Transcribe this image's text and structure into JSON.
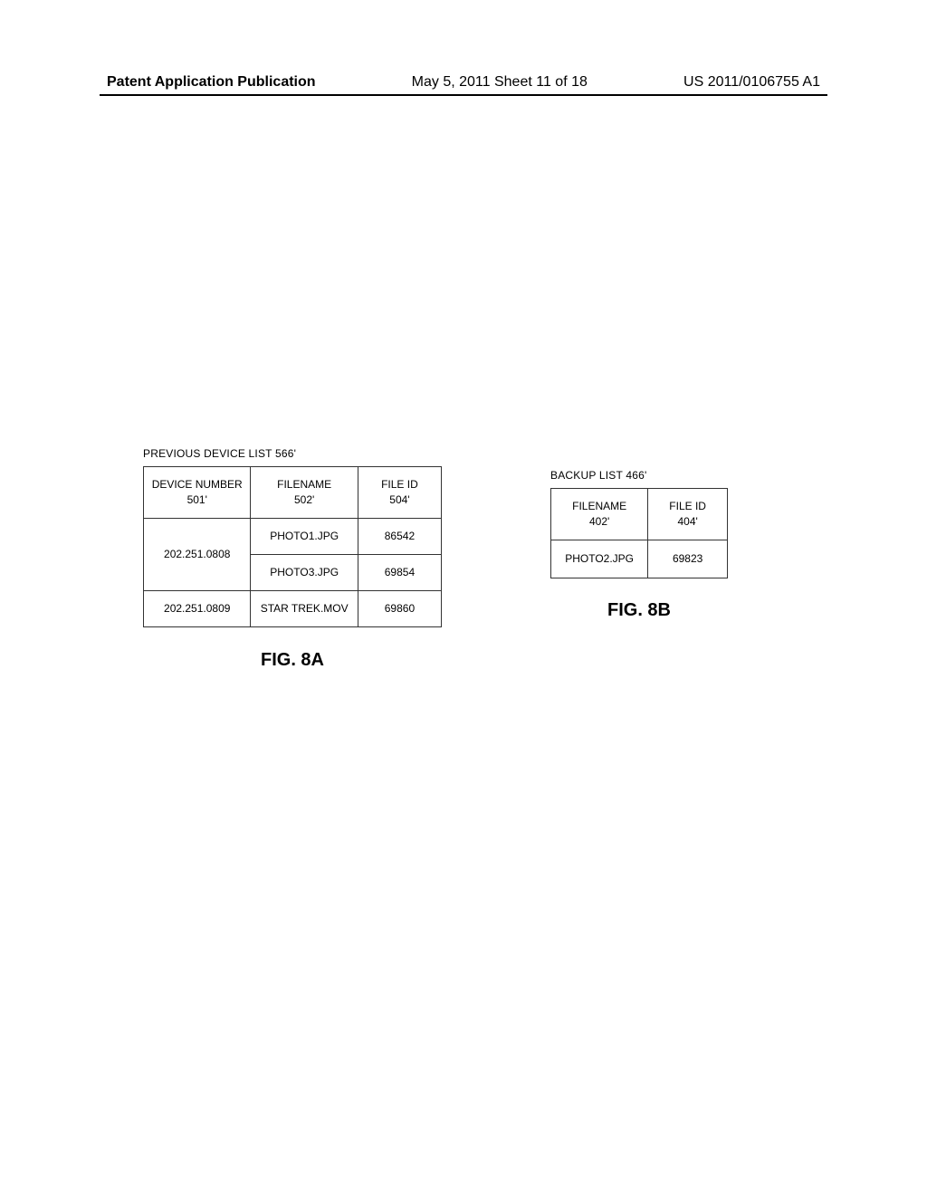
{
  "header": {
    "left": "Patent Application Publication",
    "center": "May 5, 2011  Sheet 11 of 18",
    "right": "US 2011/0106755 A1"
  },
  "figure_a": {
    "title": "PREVIOUS DEVICE LIST 566'",
    "col1_label": "DEVICE NUMBER",
    "col1_ref": "501'",
    "col2_label": "FILENAME",
    "col2_ref": "502'",
    "col3_label": "FILE ID",
    "col3_ref": "504'",
    "rows": [
      {
        "device": "202.251.0808",
        "filename": "PHOTO1.JPG",
        "fileid": "86542"
      },
      {
        "filename": "PHOTO3.JPG",
        "fileid": "69854"
      },
      {
        "device": "202.251.0809",
        "filename": "STAR TREK.MOV",
        "fileid": "69860"
      }
    ],
    "caption": "FIG. 8A"
  },
  "figure_b": {
    "title": "BACKUP LIST 466'",
    "col1_label": "FILENAME",
    "col1_ref": "402'",
    "col2_label": "FILE ID",
    "col2_ref": "404'",
    "rows": [
      {
        "filename": "PHOTO2.JPG",
        "fileid": "69823"
      }
    ],
    "caption": "FIG. 8B"
  }
}
